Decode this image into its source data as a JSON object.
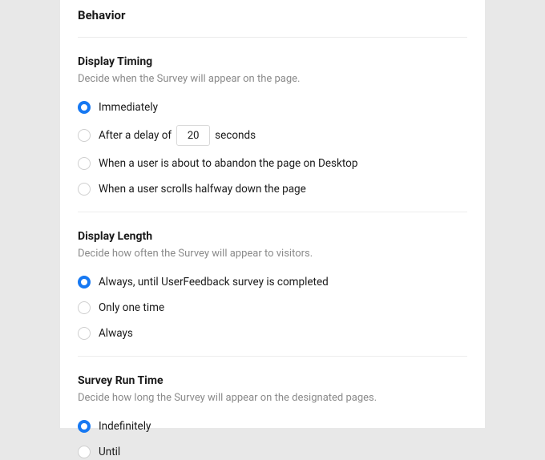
{
  "panel": {
    "title": "Behavior"
  },
  "displayTiming": {
    "title": "Display Timing",
    "desc": "Decide when the Survey will appear on the page.",
    "options": {
      "immediately": "Immediately",
      "delayPrefix": "After a delay of",
      "delayValue": "20",
      "delaySuffix": "seconds",
      "abandon": "When a user is about to abandon the page on Desktop",
      "scroll": "When a user scrolls halfway down the page"
    }
  },
  "displayLength": {
    "title": "Display Length",
    "desc": "Decide how often the Survey will appear to visitors.",
    "options": {
      "untilComplete": "Always, until UserFeedback survey is completed",
      "once": "Only one time",
      "always": "Always"
    }
  },
  "surveyRunTime": {
    "title": "Survey Run Time",
    "desc": "Decide how long the Survey will appear on the designated pages.",
    "options": {
      "indefinitely": "Indefinitely",
      "until": "Until"
    }
  }
}
